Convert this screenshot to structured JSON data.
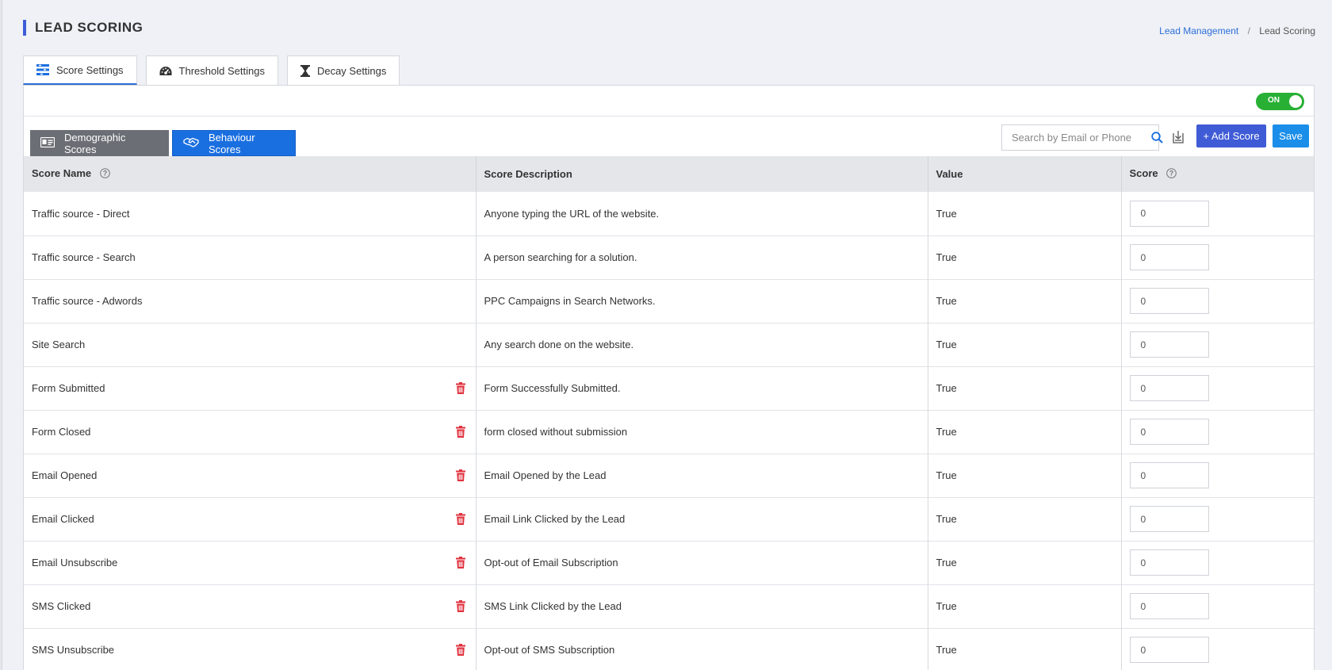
{
  "page": {
    "title": "LEAD SCORING",
    "breadcrumb": {
      "link": "Lead Management",
      "separator": "/",
      "current": "Lead Scoring"
    }
  },
  "tabs": [
    {
      "label": "Score Settings",
      "icon": "list-settings-icon",
      "active": true
    },
    {
      "label": "Threshold Settings",
      "icon": "gauge-icon",
      "active": false
    },
    {
      "label": "Decay Settings",
      "icon": "hourglass-icon",
      "active": false
    }
  ],
  "toggle": {
    "label": "ON",
    "state": true,
    "color": "#28b034"
  },
  "toolbar": {
    "demographic_label": "Demographic Scores",
    "behaviour_label": "Behaviour Scores",
    "search_placeholder": "Search by Email or Phone",
    "add_label": "+ Add Score",
    "save_label": "Save"
  },
  "colors": {
    "accent": "#3f5bd6",
    "active_blue": "#1a6fe0",
    "delete_red": "#e0313d"
  },
  "table": {
    "headers": {
      "name": "Score Name",
      "description": "Score Description",
      "value": "Value",
      "score": "Score"
    },
    "rows": [
      {
        "name": "Traffic source - Direct",
        "description": "Anyone typing the URL of the website.",
        "value": "True",
        "score": "0",
        "deletable": false
      },
      {
        "name": "Traffic source - Search",
        "description": "A person searching for a solution.",
        "value": "True",
        "score": "0",
        "deletable": false
      },
      {
        "name": "Traffic source - Adwords",
        "description": "PPC Campaigns in Search Networks.",
        "value": "True",
        "score": "0",
        "deletable": false
      },
      {
        "name": "Site Search",
        "description": "Any search done on the website.",
        "value": "True",
        "score": "0",
        "deletable": false
      },
      {
        "name": "Form Submitted",
        "description": "Form Successfully Submitted.",
        "value": "True",
        "score": "0",
        "deletable": true
      },
      {
        "name": "Form Closed",
        "description": "form closed without submission",
        "value": "True",
        "score": "0",
        "deletable": true
      },
      {
        "name": "Email Opened",
        "description": "Email Opened by the Lead",
        "value": "True",
        "score": "0",
        "deletable": true
      },
      {
        "name": "Email Clicked",
        "description": "Email Link Clicked by the Lead",
        "value": "True",
        "score": "0",
        "deletable": true
      },
      {
        "name": "Email Unsubscribe",
        "description": "Opt-out of Email Subscription",
        "value": "True",
        "score": "0",
        "deletable": true
      },
      {
        "name": "SMS Clicked",
        "description": "SMS Link Clicked by the Lead",
        "value": "True",
        "score": "0",
        "deletable": true
      },
      {
        "name": "SMS Unsubscribe",
        "description": "Opt-out of SMS Subscription",
        "value": "True",
        "score": "0",
        "deletable": true
      }
    ]
  }
}
